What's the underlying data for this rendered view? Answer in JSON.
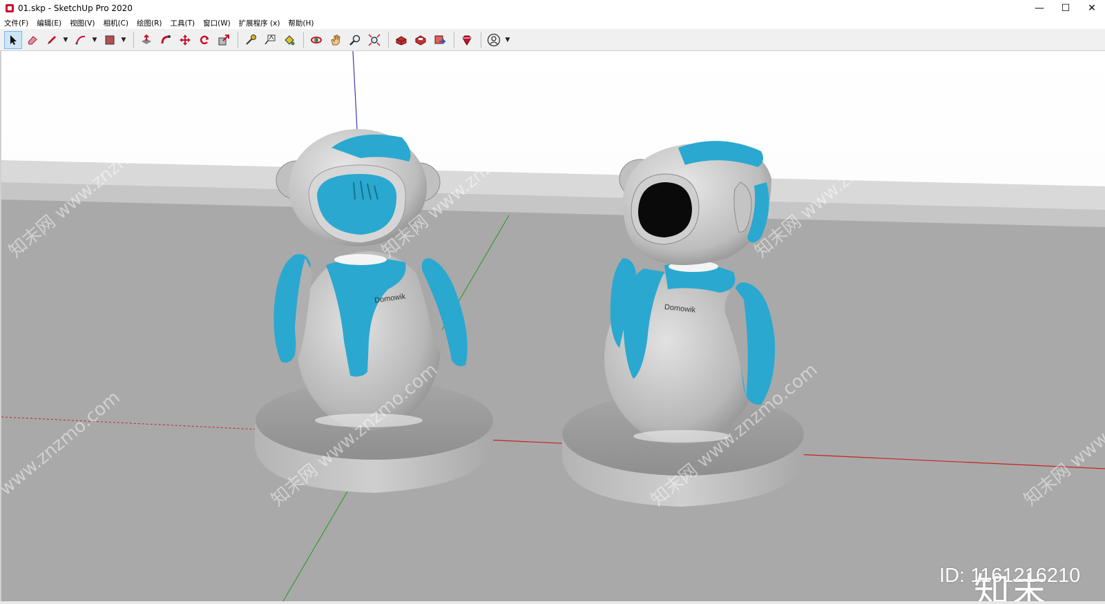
{
  "window": {
    "title": "01.skp - SketchUp Pro 2020",
    "controls": {
      "minimize": "—",
      "maximize": "☐",
      "close": "✕"
    }
  },
  "menu": [
    "文件(F)",
    "编辑(E)",
    "视图(V)",
    "相机(C)",
    "绘图(R)",
    "工具(T)",
    "窗口(W)",
    "扩展程序 (x)",
    "帮助(H)"
  ],
  "toolbar": {
    "tools": [
      "select-icon",
      "eraser-icon",
      "pencil-icon",
      "arc-icon",
      "rectangle-icon",
      "push-pull-icon",
      "follow-me-icon",
      "move-icon",
      "rotate-icon",
      "scale-icon",
      "tape-measure-icon",
      "text-label-icon",
      "paint-bucket-icon",
      "orbit-icon",
      "pan-icon",
      "zoom-icon",
      "zoom-extents-icon",
      "warehouse-icon",
      "extension-warehouse-icon",
      "send-to-layout-icon",
      "ruby-console-icon",
      "account-icon"
    ]
  },
  "scene": {
    "robot_left_label": "Domowik",
    "robot_right_label": "Domowik",
    "watermark": "知末网 www.znzmo.com",
    "accent_color": "#2aa8d0"
  },
  "brand": {
    "logo": "知末",
    "id": "ID: 1161216210"
  }
}
